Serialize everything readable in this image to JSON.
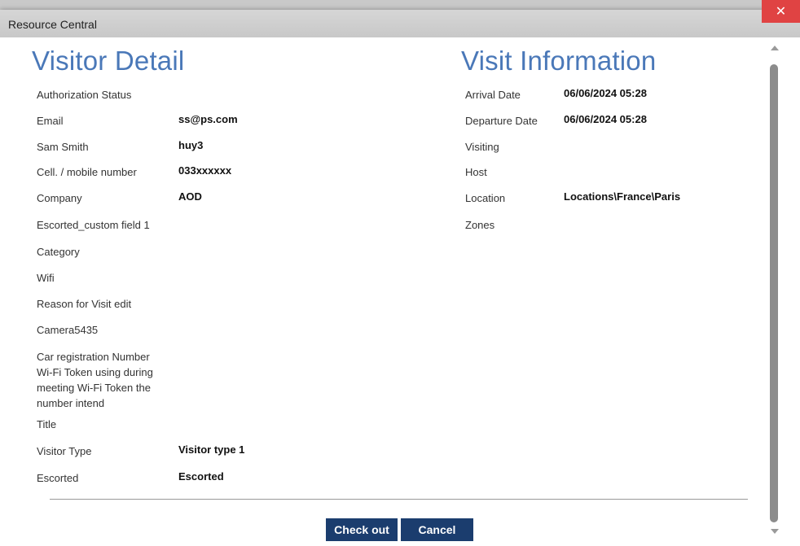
{
  "window": {
    "title": "Resource Central",
    "close_glyph": "✕"
  },
  "visitor_detail": {
    "heading": "Visitor Detail",
    "fields": [
      {
        "label": "Authorization Status",
        "value": ""
      },
      {
        "label": "Email",
        "value": "ss@ps.com"
      },
      {
        "label": "Sam Smith",
        "value": "huy3"
      },
      {
        "label": "Cell. / mobile number",
        "value": "033xxxxxx"
      },
      {
        "label": "Company",
        "value": "AOD"
      },
      {
        "label": "Escorted_custom field 1",
        "value": ""
      },
      {
        "label": "Category",
        "value": ""
      },
      {
        "label": "Wifi",
        "value": ""
      },
      {
        "label": "Reason for Visit edit",
        "value": ""
      },
      {
        "label": "Camera5435",
        "value": ""
      },
      {
        "label": "Car registration Number Wi-Fi Token using during meeting Wi-Fi Token the number intend",
        "value": ""
      },
      {
        "label": "Title",
        "value": ""
      },
      {
        "label": "Visitor Type",
        "value": "Visitor type 1"
      },
      {
        "label": "Escorted",
        "value": "Escorted"
      }
    ]
  },
  "visit_information": {
    "heading": "Visit Information",
    "fields": [
      {
        "label": "Arrival Date",
        "value": "06/06/2024 05:28"
      },
      {
        "label": "Departure Date",
        "value": "06/06/2024 05:28"
      },
      {
        "label": "Visiting",
        "value": ""
      },
      {
        "label": "Host",
        "value": ""
      },
      {
        "label": "Location",
        "value": "Locations\\France\\Paris"
      },
      {
        "label": "Zones",
        "value": ""
      }
    ]
  },
  "buttons": {
    "check_out": "Check out",
    "cancel": "Cancel"
  },
  "colors": {
    "heading": "#4a78b8",
    "button": "#1b3d6e",
    "close": "#e04343"
  }
}
